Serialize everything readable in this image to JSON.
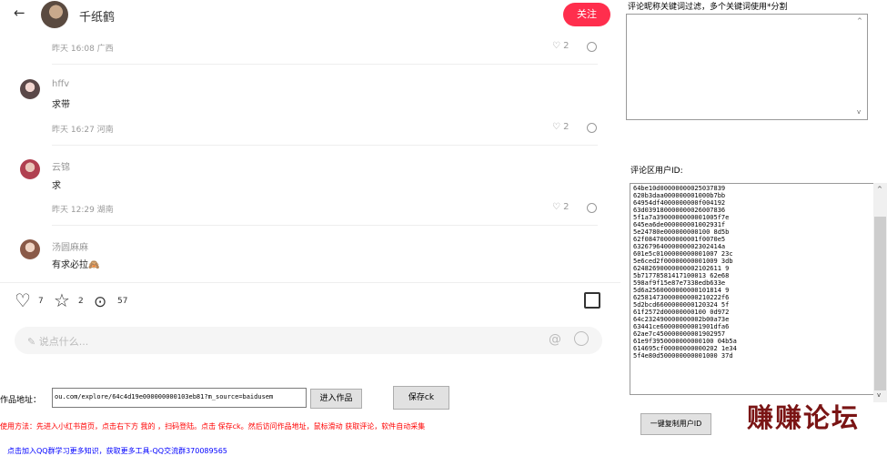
{
  "post": {
    "back_icon": "arrow-left",
    "author": "千纸鹤",
    "follow_label": "关注",
    "first_meta": "昨天 16:08 广西",
    "first_likes": "2"
  },
  "comments": [
    {
      "name": "hffv",
      "text": "求带",
      "meta": "昨天 16:27 河南",
      "likes": "2"
    },
    {
      "name": "云锦",
      "text": "求",
      "meta": "昨天 12:29 湖南",
      "likes": "2"
    },
    {
      "name": "汤圆麻麻",
      "text": "有求必拉🙈",
      "meta": "",
      "likes": ""
    }
  ],
  "action_bar": {
    "likes": "7",
    "stars": "2",
    "comments": "57"
  },
  "comment_box": {
    "placeholder": "说点什么..."
  },
  "filter": {
    "label": "评论昵称关键词过滤，多个关键词使用*分割",
    "value": ""
  },
  "uid": {
    "label": "评论区用户ID:",
    "items": [
      "64be10d00000000025037839",
      "620b3daa000000001000b7bb",
      "64954df4000000000f004192",
      "63d039180000000026007836",
      "5f1a7a3900000000001005f7e",
      "645ea6de000000001002931f",
      "5e24780e000000000100 8d5b",
      "62f08470000000001f0070e5",
      "632679640000000023024​14a",
      "601e5c0100000000001007 23c",
      "5e6ced2f00000000001009 3db",
      "62482690000000002102611 9",
      "5b71778581417100013 62e68",
      "598af9f15e87e7338edb633e",
      "5d6a2560000000000101814 9",
      "62581473000000000210222f6",
      "5d2bcd6600000000120324 5f",
      "61f2572d00000000100 0d972",
      "64c232490000000002b00a73e",
      "63441ce60000000001901dfa6",
      "62ae7c450000000001902957",
      "61e9f3950000000000100 04b5a",
      "614695cf00000000000202 1e34",
      "5f4e80d500000000001000 37d"
    ],
    "copy_button": "一键复制用户ID"
  },
  "watermark": "赚赚论坛",
  "work": {
    "url_label": "作品地址：",
    "url_value": "ou.com/explore/64c4d19e000000000103eb81?m_source=baidusem",
    "enter_button": "进入作品",
    "save_button": "保存ck"
  },
  "instructions": "使用方法：先进入小红书首页，点击右下方 我的 ，扫码登陆。点击 保存ck。然后访问作品地址，鼠标滑动 获取评论，软件自动采集",
  "footer_link": "点击加入QQ群学习更多知识，获取更多工具-QQ交流群370089565",
  "colors": {
    "accent": "#ff2e4d",
    "warning": "#ff0000",
    "link": "#0000ff",
    "watermark": "#7a1414"
  }
}
